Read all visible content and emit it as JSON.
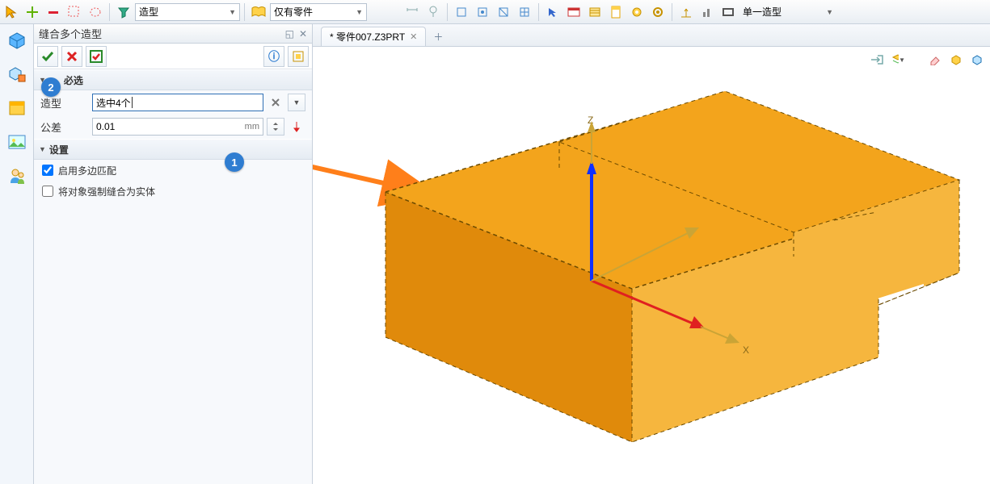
{
  "toolbar": {
    "filter1": "造型",
    "filter2": "仅有零件",
    "filter3": "单一造型"
  },
  "panel": {
    "title": "缝合多个造型",
    "section_required": "必选",
    "row_shape_label": "造型",
    "row_shape_value": "选中4个",
    "row_tol_label": "公差",
    "row_tol_value": "0.01",
    "row_tol_unit": "mm",
    "section_settings": "设置",
    "chk1": "启用多边匹配",
    "chk2": "将对象强制缝合为实体"
  },
  "tab": {
    "title": "* 零件007.Z3PRT"
  },
  "axes": {
    "x": "X",
    "z": "Z"
  },
  "badges": {
    "one": "1",
    "two": "2"
  }
}
